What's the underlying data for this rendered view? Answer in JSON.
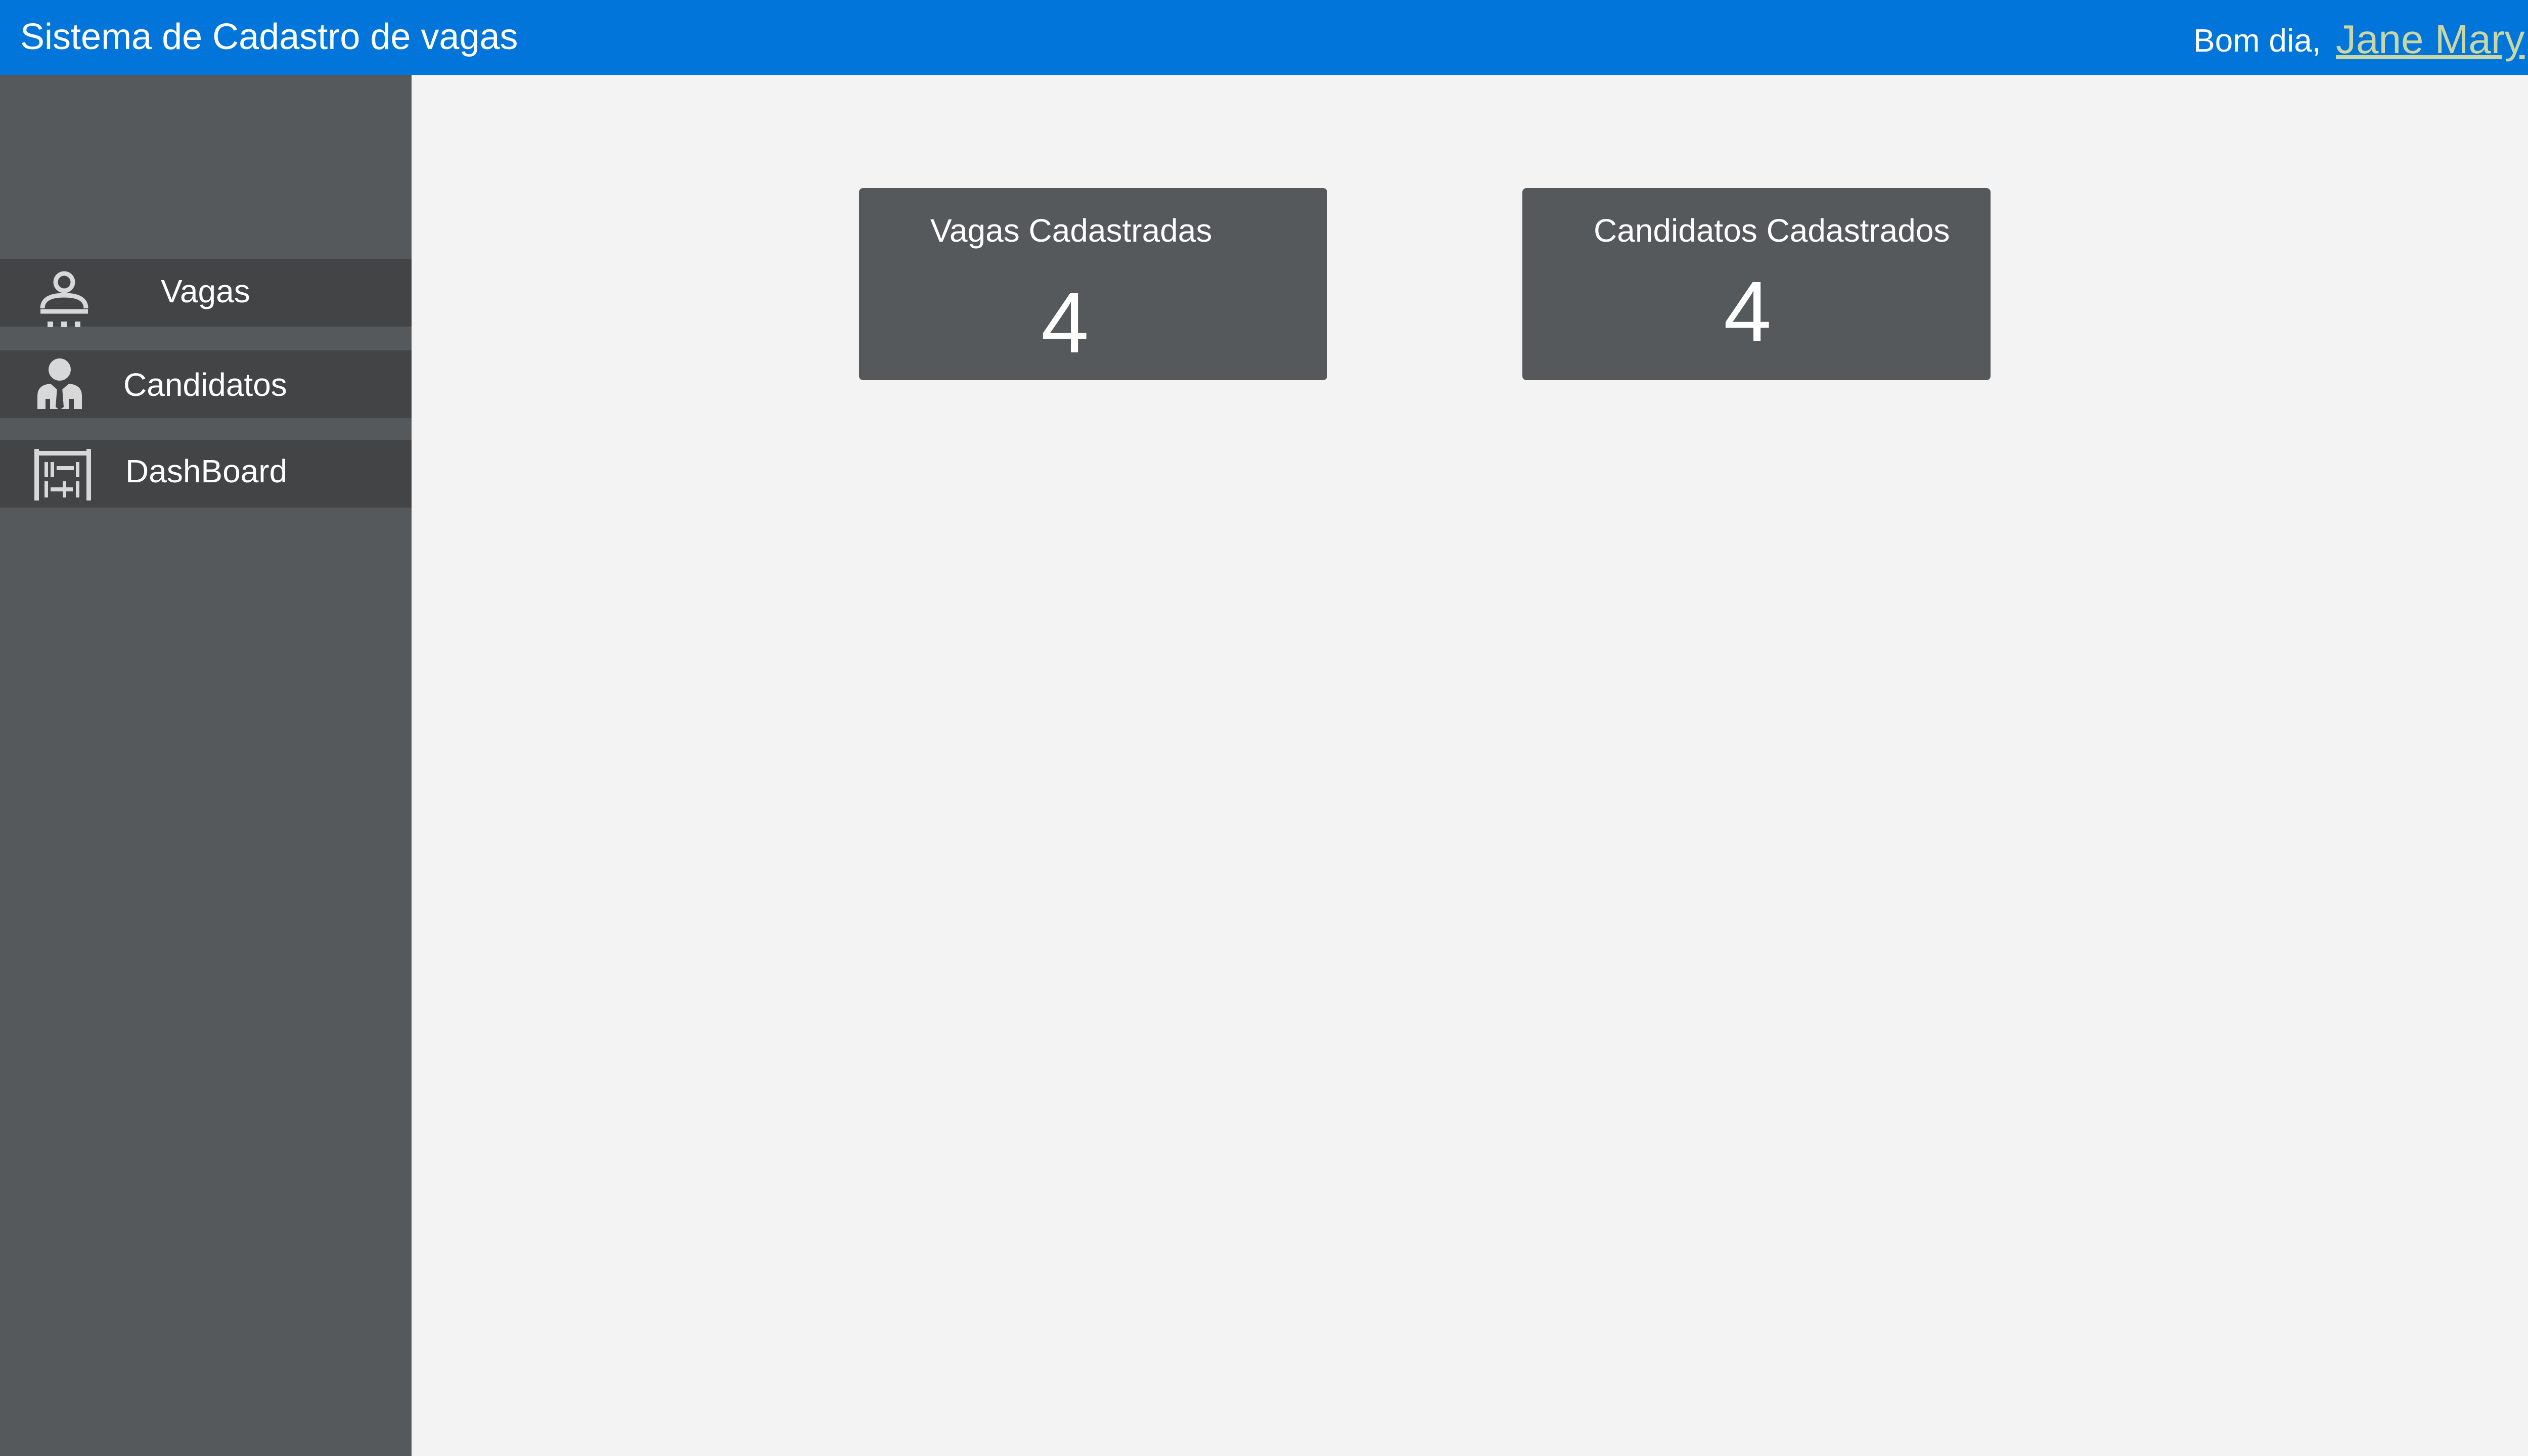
{
  "header": {
    "title": "Sistema de Cadastro de vagas",
    "greeting": "Bom dia,",
    "user_name": "Jane Mary",
    "colors": {
      "background": "#0175d9",
      "user_link": "#c9d6a5"
    }
  },
  "sidebar": {
    "items": [
      {
        "label": "Vagas",
        "icon": "person-badge-icon"
      },
      {
        "label": "Candidatos",
        "icon": "person-suit-icon"
      },
      {
        "label": "DashBoard",
        "icon": "dashboard-icon"
      }
    ]
  },
  "cards": [
    {
      "title": "Vagas Cadastradas",
      "value": "4"
    },
    {
      "title": "Candidatos Cadastrados",
      "value": "4"
    }
  ]
}
